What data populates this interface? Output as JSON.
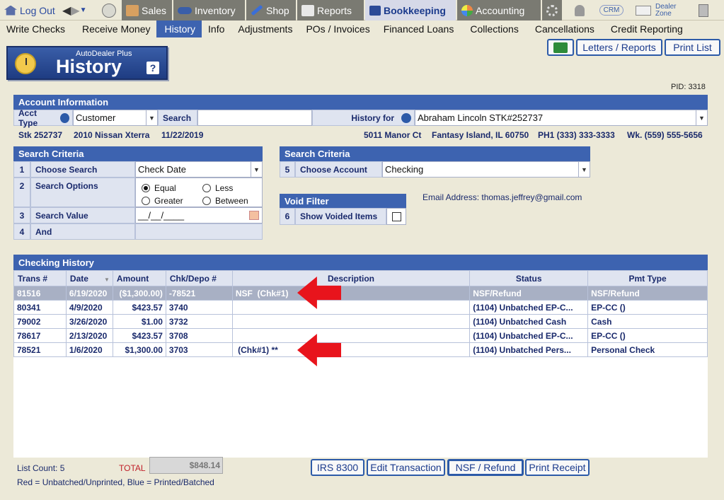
{
  "nav": {
    "logout": "Log Out",
    "sales": "Sales",
    "inventory": "Inventory",
    "shop": "Shop",
    "reports": "Reports",
    "bookkeeping": "Bookkeeping",
    "accounting": "Accounting",
    "crm": "CRM",
    "dealer_zone_1": "Dealer",
    "dealer_zone_2": "Zone"
  },
  "menu": [
    "Write Checks",
    "Receive Money",
    "History",
    "Info",
    "Adjustments",
    "POs / Invoices",
    "Financed Loans",
    "Collections",
    "Cancellations",
    "Credit Reporting"
  ],
  "badge": {
    "sub": "AutoDealer Plus",
    "title": "History",
    "help": "?"
  },
  "buttons": {
    "letters": "Letters / Reports",
    "print_list": "Print List"
  },
  "pid": "PID: 3318",
  "account": {
    "header": "Account Information",
    "acct_type_label": "Acct Type",
    "acct_type_value": "Customer",
    "search_label": "Search",
    "search_value": "",
    "history_for_label": "History for",
    "history_for_value": "Abraham Lincoln STK#252737",
    "stk": "Stk 252737",
    "vehicle": "2010 Nissan Xterra",
    "date": "11/22/2019",
    "address": "5011 Manor Ct",
    "city": "Fantasy Island, IL 60750",
    "ph1": "PH1 (333) 333-3333",
    "wk": "Wk. (559) 555-5656"
  },
  "search1": {
    "header": "Search Criteria",
    "rows": [
      {
        "num": "1",
        "label": "Choose Search",
        "value": "Check Date"
      },
      {
        "num": "2",
        "label": "Search Options"
      },
      {
        "num": "3",
        "label": "Search Value",
        "value": "__/__/____"
      },
      {
        "num": "4",
        "label": "And",
        "value": ""
      }
    ],
    "opt_equal": "Equal",
    "opt_less": "Less",
    "opt_greater": "Greater",
    "opt_between": "Between"
  },
  "search2": {
    "header": "Search Criteria",
    "num": "5",
    "label": "Choose Account",
    "value": "Checking"
  },
  "void": {
    "header": "Void Filter",
    "num": "6",
    "label": "Show Voided Items"
  },
  "email": "Email Address: thomas.jeffrey@gmail.com",
  "history": {
    "header": "Checking History",
    "columns": [
      "Trans #",
      "Date",
      "Amount",
      "Chk/Depo #",
      "Description",
      "Status",
      "Pmt Type"
    ],
    "rows": [
      [
        "81516",
        "6/19/2020",
        "($1,300.00)",
        "-78521",
        "NSF  (Chk#1)",
        "NSF/Refund",
        "NSF/Refund"
      ],
      [
        "80341",
        "4/9/2020",
        "$423.57",
        "3740",
        "",
        "(1104) Unbatched EP-C...",
        "EP-CC ()"
      ],
      [
        "79002",
        "3/26/2020",
        "$1.00",
        "3732",
        "",
        "(1104) Unbatched Cash",
        "Cash"
      ],
      [
        "78617",
        "2/13/2020",
        "$423.57",
        "3708",
        "",
        "(1104) Unbatched EP-C...",
        "EP-CC ()"
      ],
      [
        "78521",
        "1/6/2020",
        "$1,300.00",
        "3703",
        " (Chk#1) **",
        "(1104) Unbatched Pers...",
        "Personal Check"
      ]
    ]
  },
  "footer": {
    "list_count": "List Count: 5",
    "total_label": "TOTAL",
    "total_value": "$848.14",
    "legend": "Red = Unbatched/Unprinted, Blue = Printed/Batched",
    "irs": "IRS 8300",
    "edit": "Edit Transaction",
    "nsf": "NSF / Refund",
    "receipt": "Print Receipt"
  }
}
